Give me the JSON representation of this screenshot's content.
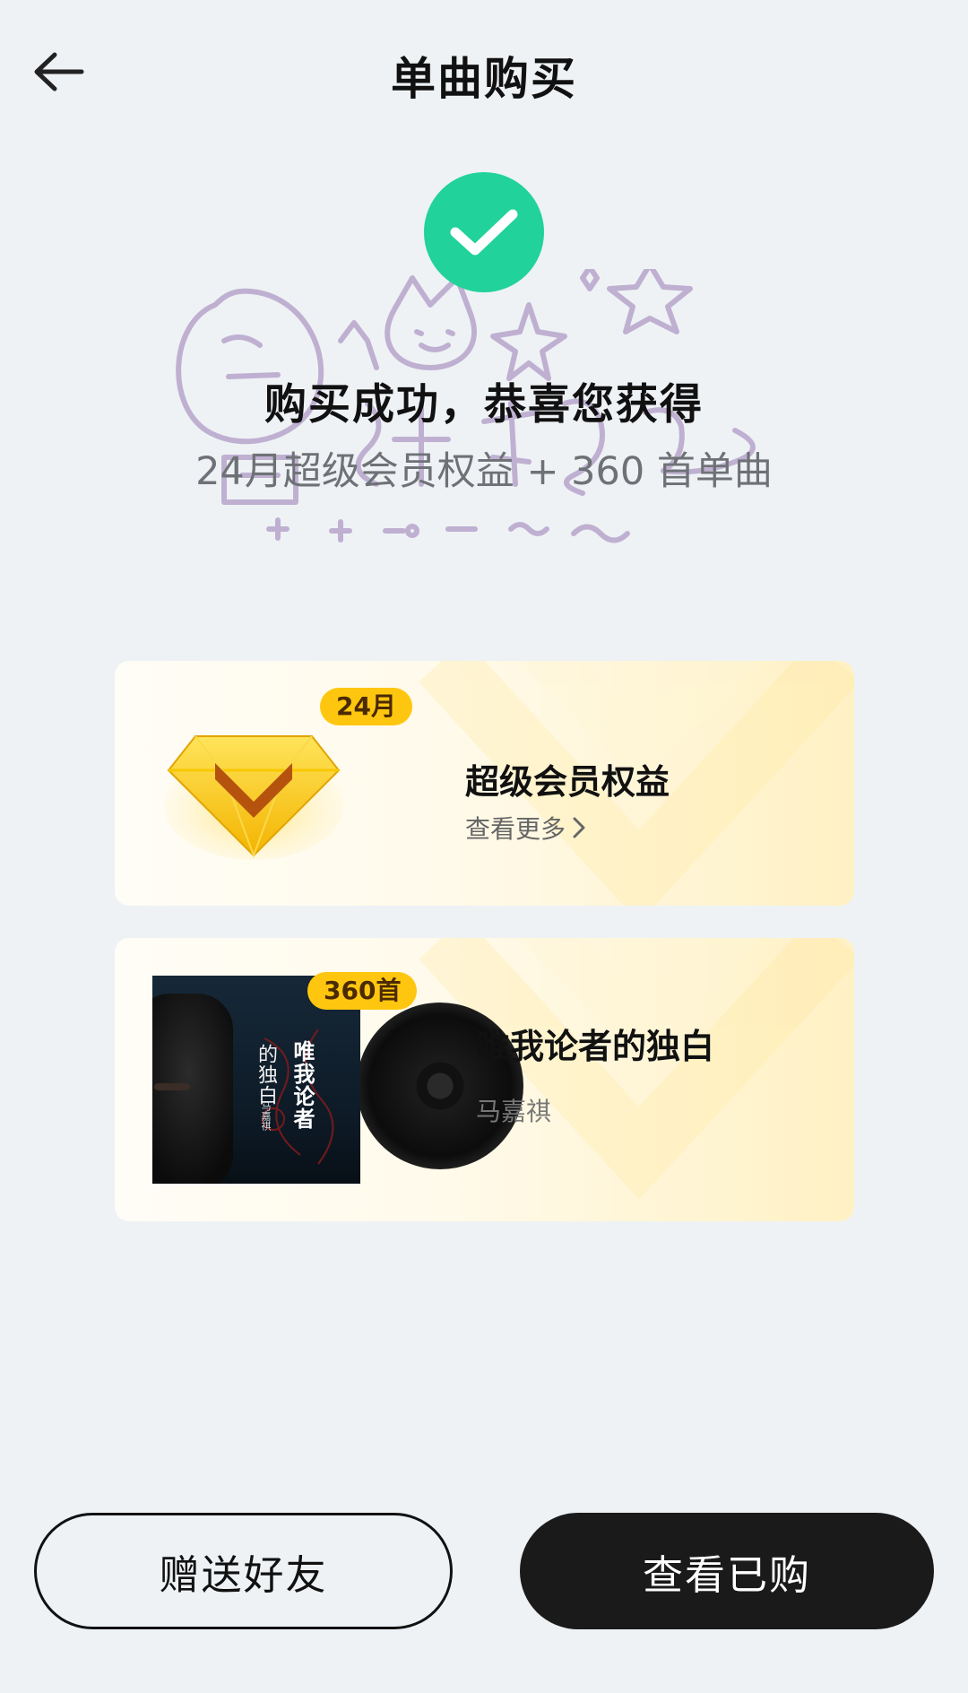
{
  "header": {
    "title": "单曲购买"
  },
  "success": {
    "title": "购买成功，恭喜您获得",
    "subtitle": "24月超级会员权益 + 360 首单曲"
  },
  "vip_card": {
    "badge": "24月",
    "title": "超级会员权益",
    "link_label": "查看更多"
  },
  "song_card": {
    "badge": "360首",
    "title": "唯我论者的独白",
    "artist": "马嘉祺",
    "album_art": {
      "title_main": "唯我论者",
      "title_side": "的独白",
      "artist": "马嘉祺"
    }
  },
  "buttons": {
    "gift": "赠送好友",
    "view_purchased": "查看已购"
  },
  "colors": {
    "success": "#21d29a",
    "badge": "#ffc60f",
    "primary_button": "#1a1a1a",
    "background": "#eef2f5"
  },
  "icons": {
    "back": "arrow-left-icon",
    "success": "check-circle-icon",
    "vip": "diamond-icon",
    "chevron": "chevron-right-icon"
  }
}
